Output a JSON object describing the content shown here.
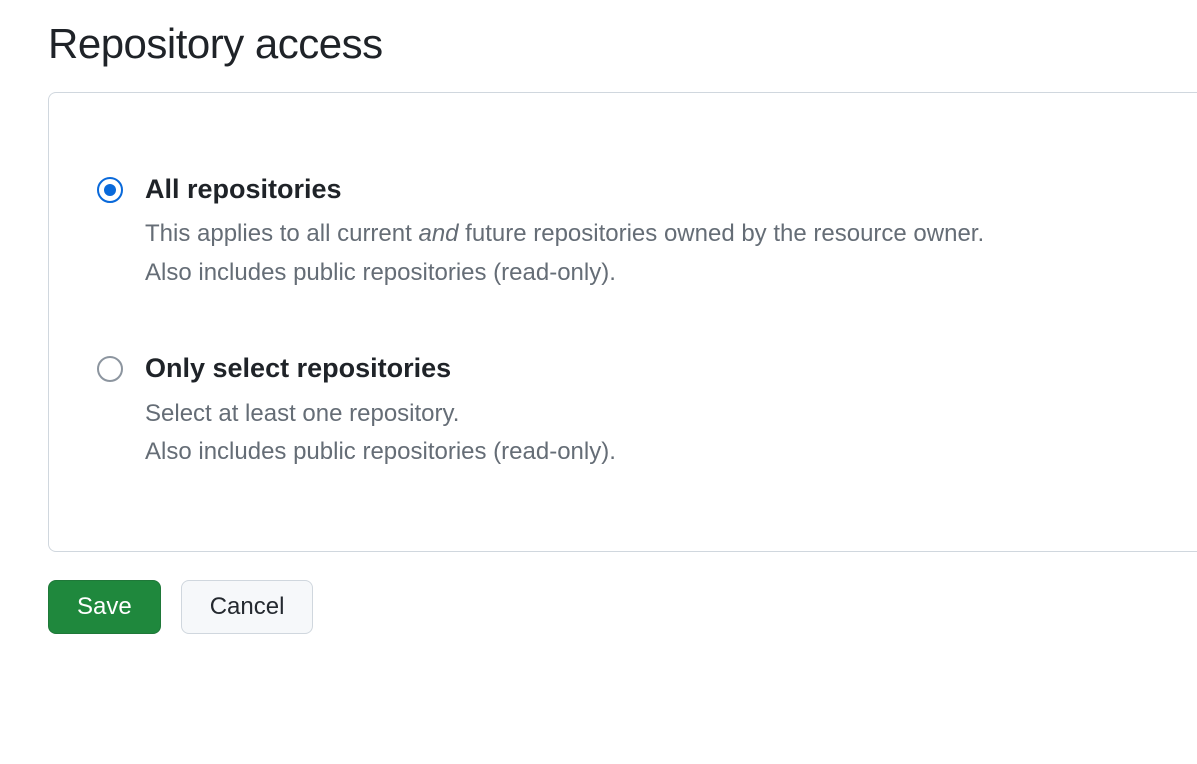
{
  "heading": "Repository access",
  "options": [
    {
      "title": "All repositories",
      "desc_pre": "This applies to all current ",
      "desc_em": "and",
      "desc_post": " future repositories owned by the resource owner.",
      "desc_line2": "Also includes public repositories (read-only).",
      "selected": true
    },
    {
      "title": "Only select repositories",
      "desc_line1": "Select at least one repository.",
      "desc_line2": "Also includes public repositories (read-only).",
      "selected": false
    }
  ],
  "buttons": {
    "save": "Save",
    "cancel": "Cancel"
  }
}
